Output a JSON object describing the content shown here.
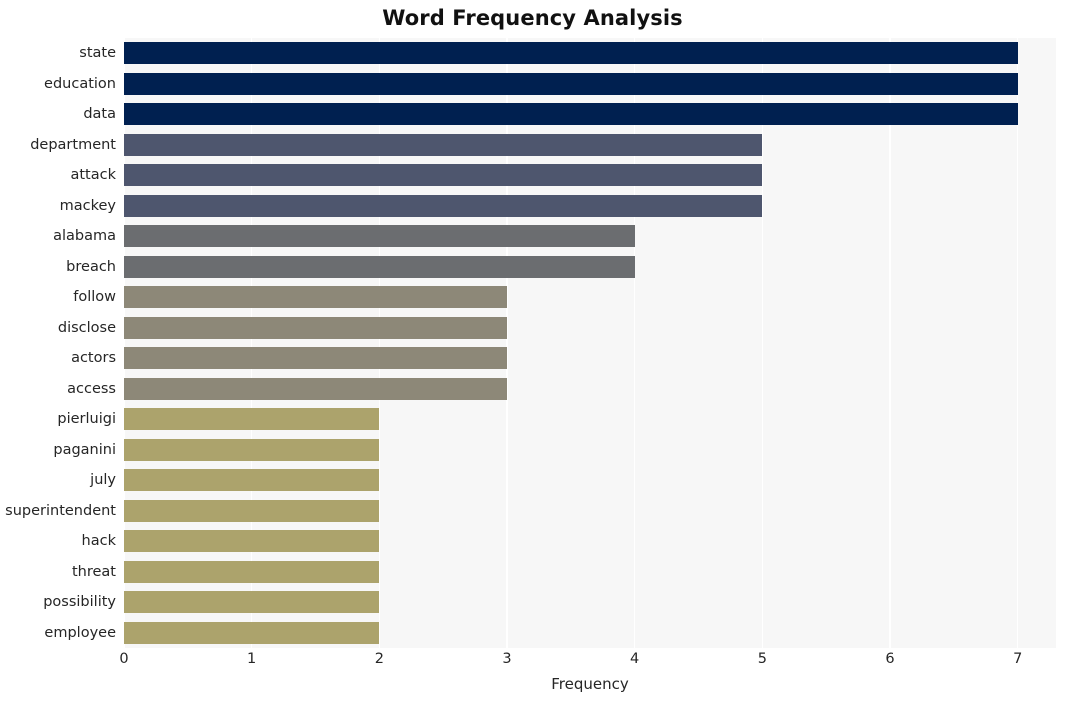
{
  "chart_data": {
    "type": "bar",
    "orientation": "horizontal",
    "title": "Word Frequency Analysis",
    "xlabel": "Frequency",
    "ylabel": "",
    "xlim": [
      0,
      7.3
    ],
    "xticks": [
      0,
      1,
      2,
      3,
      4,
      5,
      6,
      7
    ],
    "xtick_labels": [
      "0",
      "1",
      "2",
      "3",
      "4",
      "5",
      "6",
      "7"
    ],
    "grid": "vertical-only",
    "legend": "none",
    "categories": [
      "state",
      "education",
      "data",
      "department",
      "attack",
      "mackey",
      "alabama",
      "breach",
      "follow",
      "disclose",
      "actors",
      "access",
      "pierluigi",
      "paganini",
      "july",
      "superintendent",
      "hack",
      "threat",
      "possibility",
      "employee"
    ],
    "values": [
      7,
      7,
      7,
      5,
      5,
      5,
      4,
      4,
      3,
      3,
      3,
      3,
      2,
      2,
      2,
      2,
      2,
      2,
      2,
      2
    ],
    "bar_colors": [
      "#002050",
      "#002050",
      "#002050",
      "#4e566e",
      "#4e566e",
      "#4e566e",
      "#6b6d70",
      "#6b6d70",
      "#8d8878",
      "#8d8878",
      "#8d8878",
      "#8d8878",
      "#aca36c",
      "#aca36c",
      "#aca36c",
      "#aca36c",
      "#aca36c",
      "#aca36c",
      "#aca36c",
      "#aca36c"
    ],
    "plot_background": "#f7f7f7",
    "figure_background": "#ffffff",
    "gridline_color": "#ffffff"
  }
}
